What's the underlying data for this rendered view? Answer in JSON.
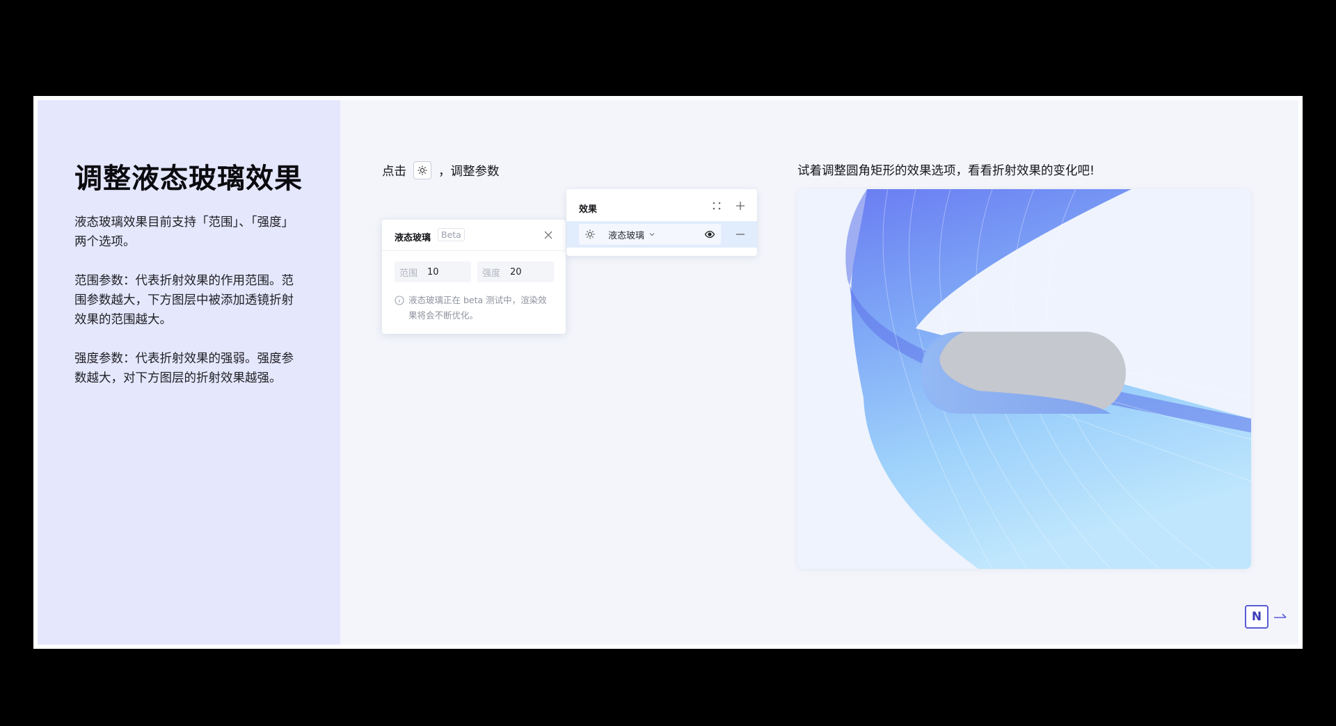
{
  "left_panel": {
    "title": "调整液态玻璃效果",
    "paragraphs": [
      "液态玻璃效果目前支持「范围」、「强度」两个选项。",
      "范围参数：代表折射效果的作用范围。范围参数越大，下方图层中被添加透镜折射效果的范围越大。",
      "强度参数：代表折射效果的强弱。强度参数越大，对下方图层的折射效果越强。"
    ]
  },
  "instructions": {
    "left_prefix": "点击",
    "left_suffix": "，调整参数",
    "right": "试着调整圆角矩形的效果选项，看看折射效果的变化吧!"
  },
  "effects_panel": {
    "title": "效果",
    "item_label": "液态玻璃",
    "icons": [
      "grid-icon",
      "plus-icon",
      "gear-icon",
      "chevron-down-icon",
      "eye-icon",
      "minus-icon"
    ]
  },
  "liquid_glass_dialog": {
    "title": "液态玻璃",
    "badge": "Beta",
    "fields": [
      {
        "label": "范围",
        "value": "10"
      },
      {
        "label": "强度",
        "value": "20"
      }
    ],
    "note": "液态玻璃正在 beta 测试中，渲染效果将会不断优化。"
  },
  "footer": {
    "next_label": "N"
  },
  "colors": {
    "left_panel_bg": "#e5e7fd",
    "canvas_bg": "#f3f5fb",
    "accent": "#5b5bd6",
    "selected_row": "#e1ecfd"
  }
}
